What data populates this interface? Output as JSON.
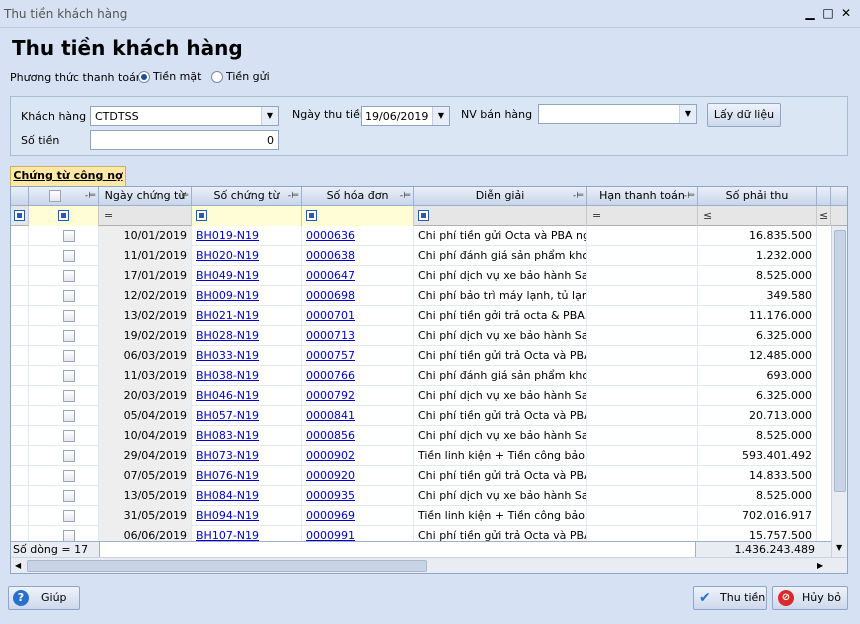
{
  "window": {
    "title": "Thu tiền khách hàng"
  },
  "heading": "Thu tiền khách hàng",
  "payment": {
    "label": "Phương thức thanh toán",
    "options": [
      "Tiền mặt",
      "Tiền gửi"
    ],
    "selected": "Tiền mặt"
  },
  "filters": {
    "customer_label": "Khách hàng",
    "customer_value": "CTDTSS",
    "date_label": "Ngày thu tiền",
    "date_value": "19/06/2019",
    "salesperson_label": "NV bán hàng",
    "salesperson_value": "",
    "fetch_button": "Lấy dữ liệu",
    "amount_label": "Số tiền",
    "amount_value": "0"
  },
  "tab": {
    "label": "Chứng từ công nợ"
  },
  "grid": {
    "columns": [
      "Ngày chứng từ",
      "Số chứng từ",
      "Số hóa đơn",
      "Diễn giải",
      "Hạn thanh toán",
      "Số phải thu"
    ],
    "filter_ops": {
      "due": "=",
      "date": "=",
      "amount": "≤",
      "extra": "≤"
    },
    "rows": [
      {
        "date": "10/01/2019",
        "doc": "BH019-N19",
        "inv": "0000636",
        "desc": "Chi phí tiền gửi Octa và PBA ng...",
        "due": "",
        "amount": "16.835.500"
      },
      {
        "date": "11/01/2019",
        "doc": "BH020-N19",
        "inv": "0000638",
        "desc": "Chi phí đánh giá sản phẩm kho...",
        "due": "",
        "amount": "1.232.000"
      },
      {
        "date": "17/01/2019",
        "doc": "BH049-N19",
        "inv": "0000647",
        "desc": "Chi phí dịch vụ xe bảo hành Sa...",
        "due": "",
        "amount": "8.525.000"
      },
      {
        "date": "12/02/2019",
        "doc": "BH009-N19",
        "inv": "0000698",
        "desc": "Chi phí bảo trì máy lạnh, tủ lạnh...",
        "due": "",
        "amount": "349.580"
      },
      {
        "date": "13/02/2019",
        "doc": "BH021-N19",
        "inv": "0000701",
        "desc": "Chi phí tiền gởi trả octa & PBA...",
        "due": "",
        "amount": "11.176.000"
      },
      {
        "date": "19/02/2019",
        "doc": "BH028-N19",
        "inv": "0000713",
        "desc": "Chi phí dịch vụ xe bảo hành Sa...",
        "due": "",
        "amount": "6.325.000"
      },
      {
        "date": "06/03/2019",
        "doc": "BH033-N19",
        "inv": "0000757",
        "desc": "Chi phí tiền gửi trả Octa và PBA...",
        "due": "",
        "amount": "12.485.000"
      },
      {
        "date": "11/03/2019",
        "doc": "BH038-N19",
        "inv": "0000766",
        "desc": "Chi phí đánh giá sản phẩm kho...",
        "due": "",
        "amount": "693.000"
      },
      {
        "date": "20/03/2019",
        "doc": "BH046-N19",
        "inv": "0000792",
        "desc": "Chi phí dịch vụ xe bảo hành Sa...",
        "due": "",
        "amount": "6.325.000"
      },
      {
        "date": "05/04/2019",
        "doc": "BH057-N19",
        "inv": "0000841",
        "desc": "Chi phí tiền gửi trả Octa và PBA...",
        "due": "",
        "amount": "20.713.000"
      },
      {
        "date": "10/04/2019",
        "doc": "BH083-N19",
        "inv": "0000856",
        "desc": "Chi phí dịch vụ xe bảo hành Sa...",
        "due": "",
        "amount": "8.525.000"
      },
      {
        "date": "29/04/2019",
        "doc": "BH073-N19",
        "inv": "0000902",
        "desc": "Tiền linh kiện + Tiền công bảo...",
        "due": "",
        "amount": "593.401.492"
      },
      {
        "date": "07/05/2019",
        "doc": "BH076-N19",
        "inv": "0000920",
        "desc": "Chi phí tiền gửi trả Octa và PBA...",
        "due": "",
        "amount": "14.833.500"
      },
      {
        "date": "13/05/2019",
        "doc": "BH084-N19",
        "inv": "0000935",
        "desc": "Chi phí dịch vụ xe bảo hành Sa...",
        "due": "",
        "amount": "8.525.000"
      },
      {
        "date": "31/05/2019",
        "doc": "BH094-N19",
        "inv": "0000969",
        "desc": "Tiền linh kiện + Tiền công bảo...",
        "due": "",
        "amount": "702.016.917"
      },
      {
        "date": "06/06/2019",
        "doc": "BH107-N19",
        "inv": "0000991",
        "desc": "Chi phí tiền gửi trả Octa và PBA...",
        "due": "",
        "amount": "15.757.500"
      }
    ],
    "row_count_label": "Số dòng = 17",
    "total_amount": "1.436.243.489"
  },
  "buttons": {
    "help": "Giúp",
    "collect": "Thu tiền",
    "cancel": "Hủy bỏ"
  },
  "icons": {
    "pin": "pin-icon",
    "check": "checkmark-icon",
    "help": "help-icon",
    "cancel": "cancel-icon"
  },
  "colors": {
    "accent": "#1d4e9a",
    "link": "#0000cc",
    "tab": "#fde8a5",
    "background": "#d6e2f3"
  }
}
